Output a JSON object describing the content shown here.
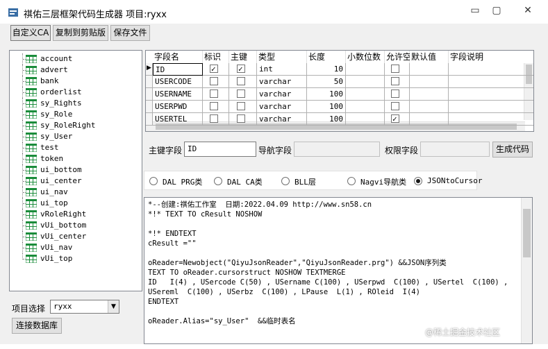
{
  "window": {
    "title": "祺佑三层框架代码生成器 项目:ryxx"
  },
  "toolbar": {
    "custom_ca": "自定义CA",
    "copy": "复制到剪贴版",
    "save": "保存文件"
  },
  "tree": {
    "items": [
      "account",
      "advert",
      "bank",
      "orderlist",
      "sy_Rights",
      "sy_Role",
      "sy_RoleRight",
      "sy_User",
      "test",
      "token",
      "ui_bottom",
      "ui_center",
      "ui_nav",
      "ui_top",
      "vRoleRight",
      "vUi_bottom",
      "vUi_center",
      "vUi_nav",
      "vUi_top"
    ]
  },
  "grid": {
    "headers": [
      "字段名",
      "标识",
      "主键",
      "类型",
      "长度",
      "小数位数",
      "允许空",
      "默认值",
      "字段说明"
    ],
    "rows": [
      {
        "name": "ID",
        "identity": true,
        "pk": true,
        "type": "int",
        "length": "10",
        "allow_null": false
      },
      {
        "name": "USERCODE",
        "identity": false,
        "pk": false,
        "type": "varchar",
        "length": "50",
        "allow_null": false
      },
      {
        "name": "USERNAME",
        "identity": false,
        "pk": false,
        "type": "varchar",
        "length": "100",
        "allow_null": false
      },
      {
        "name": "USERPWD",
        "identity": false,
        "pk": false,
        "type": "varchar",
        "length": "100",
        "allow_null": false
      },
      {
        "name": "USERTEL",
        "identity": false,
        "pk": false,
        "type": "varchar",
        "length": "100",
        "allow_null": true
      }
    ]
  },
  "fields": {
    "pk_label": "主键字段",
    "pk_value": "ID",
    "nav_label": "导航字段",
    "nav_value": "",
    "perm_label": "权限字段",
    "perm_value": "",
    "generate": "生成代码"
  },
  "radios": [
    {
      "label": "DAL PRG类",
      "selected": false
    },
    {
      "label": "DAL CA类",
      "selected": false
    },
    {
      "label": "BLL层",
      "selected": false
    },
    {
      "label": "Nagvi导航类",
      "selected": false
    },
    {
      "label": "JSONtoCursor",
      "selected": true
    }
  ],
  "code": {
    "lines": [
      "*--创建:祺佑工作室  日期:2022.04.09 http://www.sn58.cn",
      "*!* TEXT TO cResult NOSHOW",
      "",
      "*!* ENDTEXT",
      "cResult =\"\"",
      "",
      "oReader=Newobject(\"QiyuJsonReader\",\"QiyuJsonReader.prg\") &&JSON序列类",
      "TEXT TO oReader.cursorstruct NOSHOW TEXTMERGE",
      "ID   I(4) , USercode C(50) , USername C(100) , USerpwd  C(100) , USertel  C(100) ,",
      "USereml  C(100) , USerbz  C(100) , LPause  L(1) , ROleid  I(4)",
      "ENDTEXT",
      "",
      "oReader.Alias=\"sy_User\"  &&临时表名"
    ]
  },
  "bottom": {
    "project_label": "项目选择",
    "project_value": "ryxx",
    "connect": "连接数据库"
  },
  "watermark": "@稀土掘金技术社区"
}
